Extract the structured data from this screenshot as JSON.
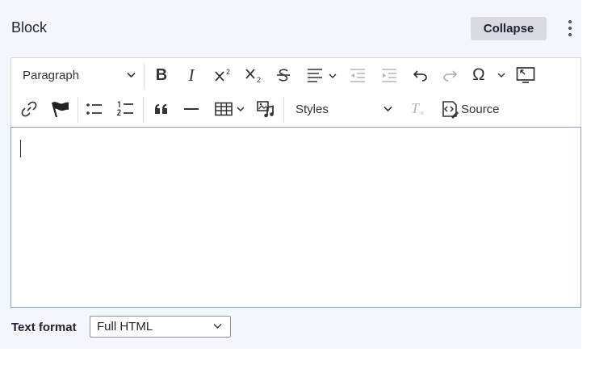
{
  "block": {
    "title": "Block",
    "collapse_label": "Collapse"
  },
  "toolbar": {
    "paragraph_label": "Paragraph",
    "styles_label": "Styles",
    "source_label": "Source",
    "bold_label": "B",
    "italic_label": "I",
    "special_char_label": "Ω",
    "icons": [
      "bold-icon",
      "italic-icon",
      "superscript-icon",
      "subscript-icon",
      "strikethrough-icon",
      "align-icon",
      "outdent-icon",
      "indent-icon",
      "undo-icon",
      "redo-icon",
      "special-characters-icon",
      "fullscreen-icon",
      "link-icon",
      "flag-icon",
      "bulleted-list-icon",
      "numbered-list-icon",
      "blockquote-icon",
      "horizontal-line-icon",
      "table-icon",
      "media-icon",
      "remove-format-icon",
      "source-icon"
    ]
  },
  "text_format": {
    "label": "Text format",
    "selected": "Full HTML"
  },
  "colors": {
    "panel_bg": "#f3f6fc",
    "editor_border": "#8c9cc0",
    "button_bg": "#d7dae0"
  }
}
